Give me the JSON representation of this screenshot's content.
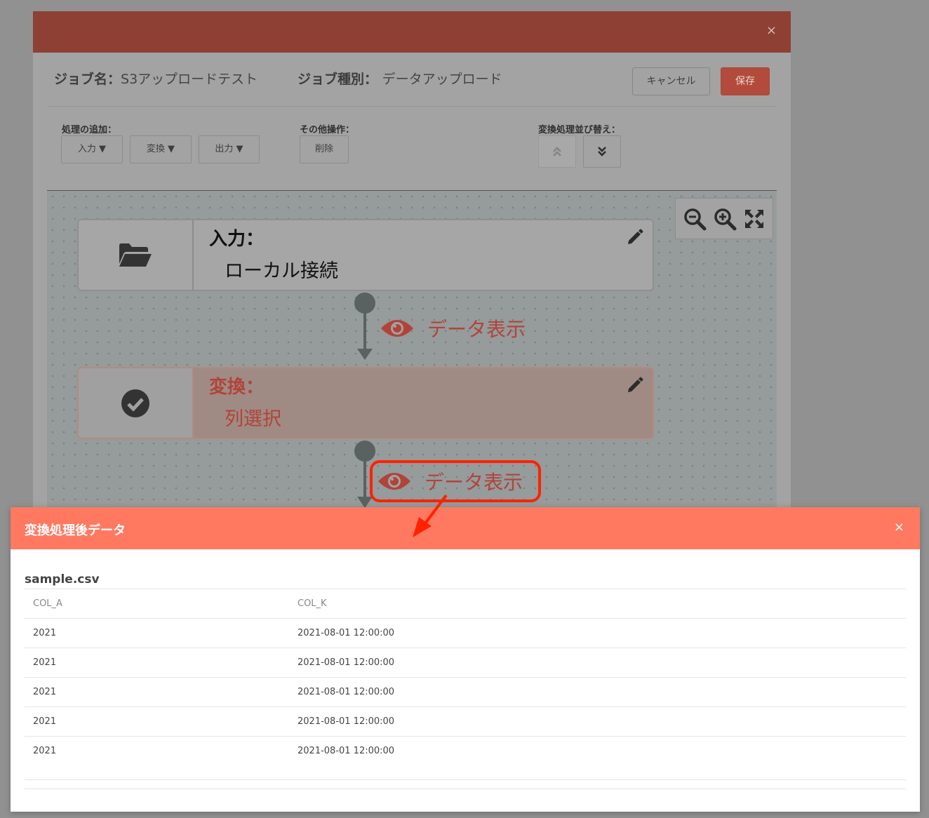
{
  "job": {
    "name_label": "ジョブ名：",
    "name_value": "S3アップロードテスト",
    "type_label": "ジョブ種別：",
    "type_value": "データアップロード",
    "cancel_label": "キャンセル",
    "save_label": "保存",
    "close_glyph": "×"
  },
  "toolbar": {
    "add_label": "処理の追加：",
    "input_btn": "入力 ▼",
    "transform_btn": "変換 ▼",
    "output_btn": "出力 ▼",
    "other_label": "その他操作：",
    "delete_btn": "削除",
    "reorder_label": "変換処理並び替え："
  },
  "flow": {
    "nodes": [
      {
        "kind": "入力：",
        "name": "ローカル接続",
        "icon": "folder-open-icon"
      },
      {
        "kind": "変換：",
        "name": "列選択",
        "icon": "check-circle-icon"
      }
    ],
    "data_view_label": "データ表示"
  },
  "data_modal": {
    "title": "変換処理後データ",
    "close_glyph": "×",
    "file_name": "sample.csv",
    "columns": [
      "COL_A",
      "COL_K"
    ],
    "rows": [
      [
        "2021",
        "2021-08-01 12:00:00"
      ],
      [
        "2021",
        "2021-08-01 12:00:00"
      ],
      [
        "2021",
        "2021-08-01 12:00:00"
      ],
      [
        "2021",
        "2021-08-01 12:00:00"
      ],
      [
        "2021",
        "2021-08-01 12:00:00"
      ]
    ]
  },
  "colors": {
    "header_dim": "#8e4034",
    "accent": "#ff7961",
    "highlight": "#ff2200",
    "node_text_red": "#b0443a"
  }
}
